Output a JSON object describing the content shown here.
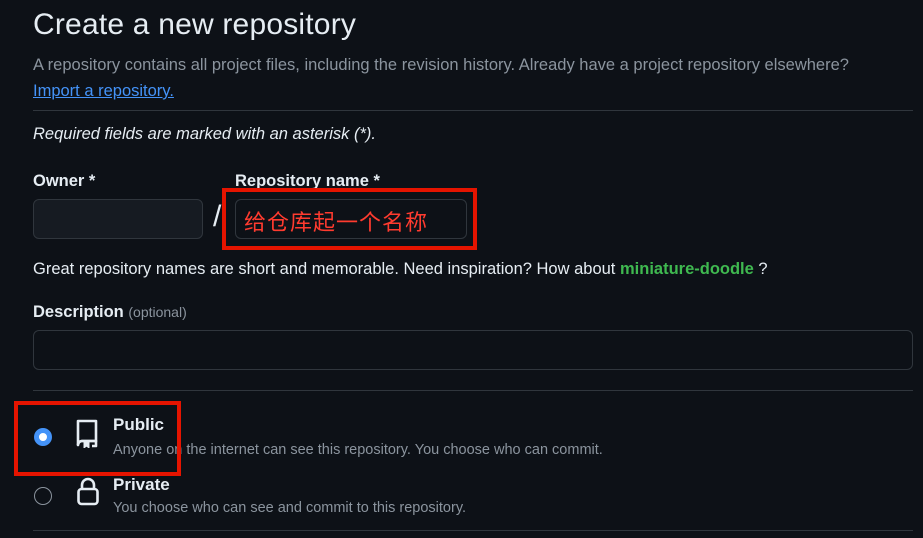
{
  "page": {
    "title": "Create a new repository",
    "subtitle": "A repository contains all project files, including the revision history. Already have a project repository elsewhere?",
    "import_link": "Import a repository.",
    "required_note": "Required fields are marked with an asterisk (*)."
  },
  "owner": {
    "label": "Owner *",
    "value": ""
  },
  "separator": "/",
  "repo_name": {
    "label": "Repository name *",
    "annotation": "给仓库起一个名称"
  },
  "hint": {
    "text": "Great repository names are short and memorable. Need inspiration? How about",
    "suggestion": "miniature-doodle",
    "suffix": "?"
  },
  "description": {
    "label": "Description",
    "optional": "(optional)",
    "value": ""
  },
  "visibility": {
    "public": {
      "title": "Public",
      "desc": "Anyone on the internet can see this repository. You choose who can commit.",
      "selected": true,
      "icon": "repo-icon"
    },
    "private": {
      "title": "Private",
      "desc": "You choose who can see and commit to this repository.",
      "selected": false,
      "icon": "lock-icon"
    }
  },
  "colors": {
    "background": "#0d1117",
    "accent": "#4493f8",
    "suggestion": "#3fb950",
    "annotation_red": "#e51400"
  }
}
